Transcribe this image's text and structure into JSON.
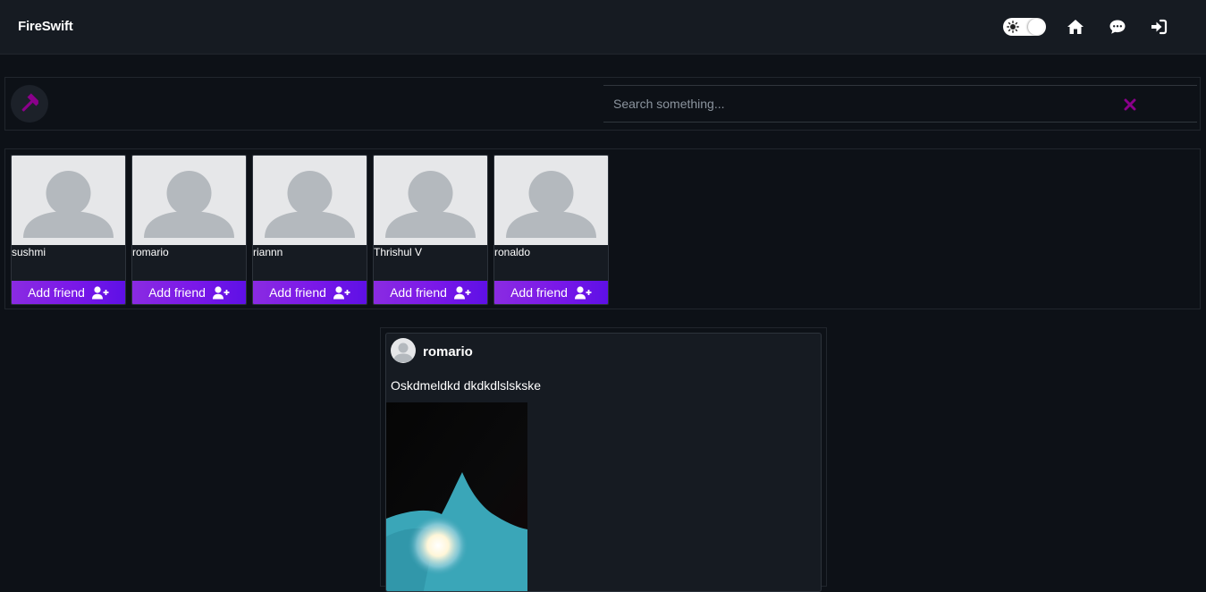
{
  "navbar": {
    "brand": "FireSwift",
    "icons": [
      "theme-toggle",
      "home-icon",
      "chat-icon",
      "login-icon"
    ]
  },
  "search": {
    "placeholder": "Search something...",
    "value": ""
  },
  "suggestions": [
    {
      "name": "sushmi",
      "button": "Add friend"
    },
    {
      "name": "romario",
      "button": "Add friend"
    },
    {
      "name": "riannn",
      "button": "Add friend"
    },
    {
      "name": "Thrishul V",
      "button": "Add friend"
    },
    {
      "name": "ronaldo",
      "button": "Add friend"
    }
  ],
  "post": {
    "author": "romario",
    "text": "Oskdmeldkd dkdkdlslskske"
  },
  "colors": {
    "background": "#0d1117",
    "navbar": "#161b22",
    "accent": "#8a2be2",
    "accent_dark": "#5e10e6",
    "icon_purple": "#8b008b"
  }
}
